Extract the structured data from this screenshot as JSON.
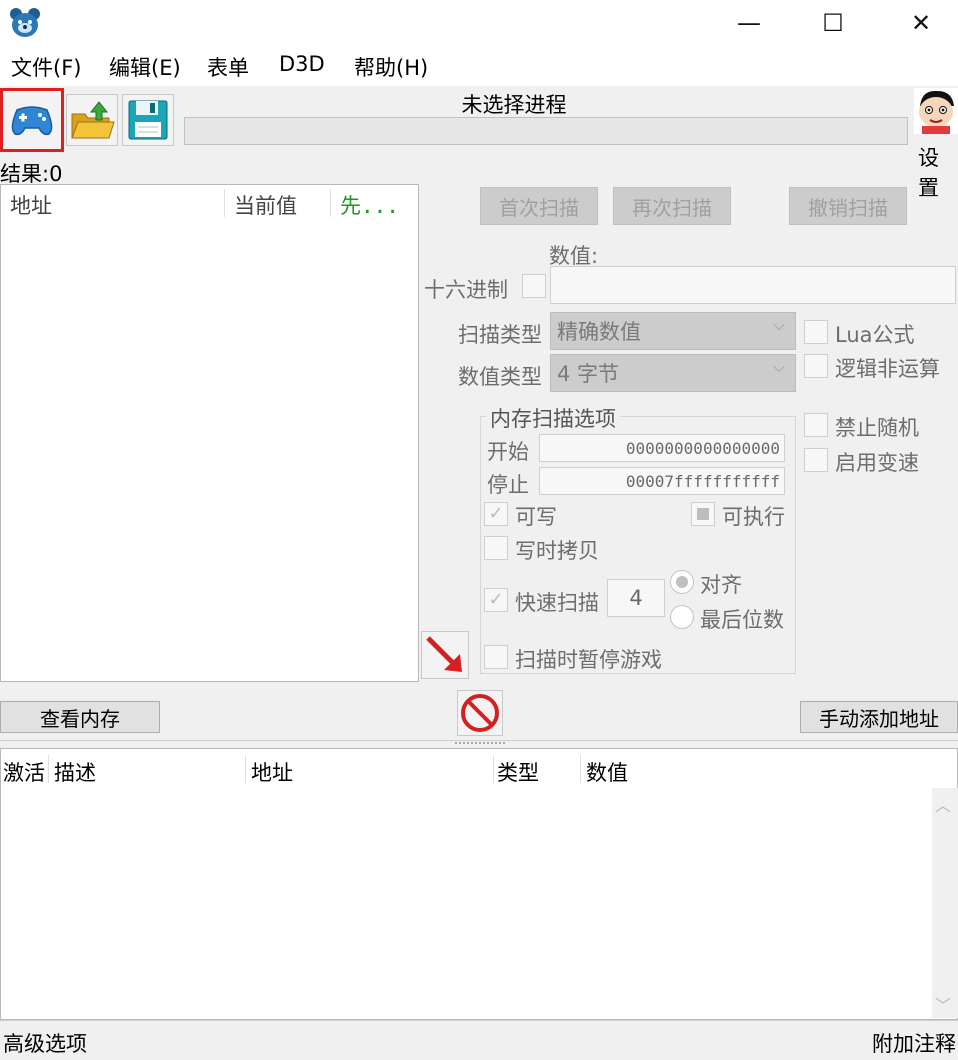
{
  "window": {
    "minimize": "—",
    "maximize": "☐",
    "close": "✕"
  },
  "menu": [
    "文件(F)",
    "编辑(E)",
    "表单",
    "D3D",
    "帮助(H)"
  ],
  "process_title": "未选择进程",
  "settings_label": "设置",
  "results_label": "结果:0",
  "results_columns": [
    "地址",
    "当前值",
    "先..."
  ],
  "scan_buttons": {
    "first": "首次扫描",
    "next": "再次扫描",
    "undo": "撤销扫描"
  },
  "value_label": "数值:",
  "hex_label": "十六进制",
  "scan_type": {
    "label": "扫描类型",
    "value": "精确数值"
  },
  "value_type": {
    "label": "数值类型",
    "value": "4 字节"
  },
  "right_options": [
    "Lua公式",
    "逻辑非运算",
    "禁止随机",
    "启用变速"
  ],
  "mem_options": {
    "title": "内存扫描选项",
    "start_label": "开始",
    "start_value": "0000000000000000",
    "stop_label": "停止",
    "stop_value": "00007fffffffffff",
    "writable": "可写",
    "executable": "可执行",
    "copy_on_write": "写时拷贝",
    "fast_scan": "快速扫描",
    "fast_scan_value": "4",
    "align": "对齐",
    "last_digits": "最后位数",
    "pause_game": "扫描时暂停游戏"
  },
  "view_memory": "查看内存",
  "add_address": "手动添加地址",
  "table_columns": [
    "激活",
    "描述",
    "地址",
    "类型",
    "数值"
  ],
  "footer": {
    "left": "高级选项",
    "right": "附加注释"
  },
  "colors": {
    "selected_border": "#e02020",
    "prev_value_header": "#1a9a1a",
    "arrow": "#d42020"
  }
}
